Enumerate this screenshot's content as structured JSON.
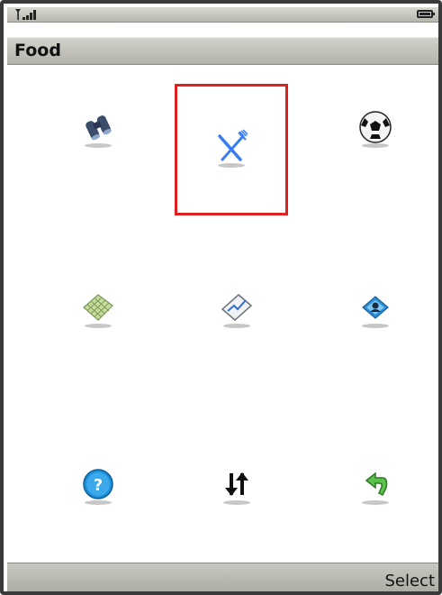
{
  "status": {
    "signal_icon": "signal-strength-icon",
    "battery_icon": "battery-icon"
  },
  "header": {
    "title": "Food"
  },
  "menu": {
    "items": [
      {
        "icon": "binoculars-icon",
        "selected": false
      },
      {
        "icon": "fork-knife-icon",
        "selected": true
      },
      {
        "icon": "soccer-ball-icon",
        "selected": false
      },
      {
        "icon": "map-grid-icon",
        "selected": false
      },
      {
        "icon": "chart-icon",
        "selected": false
      },
      {
        "icon": "contacts-icon",
        "selected": false
      },
      {
        "icon": "help-icon",
        "selected": false
      },
      {
        "icon": "sort-arrows-icon",
        "selected": false
      },
      {
        "icon": "back-arrow-icon",
        "selected": false
      }
    ]
  },
  "softkeys": {
    "right_label": "Select"
  },
  "colors": {
    "selection_border": "#e02020",
    "bar_gray": "#b3b3ab"
  }
}
